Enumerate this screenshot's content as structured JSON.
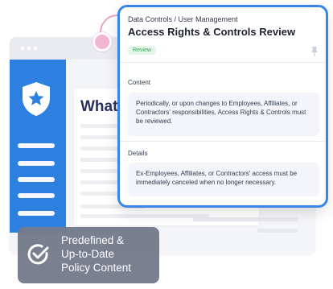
{
  "background": {
    "heading": "What"
  },
  "popup": {
    "breadcrumb": "Data Controls / User Management",
    "title": "Access Rights & Controls Review",
    "status_badge": "Review",
    "content_label": "Content",
    "content_text": "Periodically, or upon changes to Employees, Affiliates, or Contractors' responsibilities, Access Rights & Controls must be reviewed.",
    "details_label": "Details",
    "details_text": "Ex-Employees, Affiliates, or Contractors' access must be immediately canceled when no longer necessary."
  },
  "feature_badge": {
    "lines": [
      "Predefined &",
      "Up-to-Date",
      "Policy Content"
    ]
  },
  "colors": {
    "accent_blue": "#2d7fe0",
    "popup_border": "#3a86e6",
    "badge_bg": "#767b8c",
    "review_green": "#39a75c",
    "connector_pink": "#e8a6c9"
  },
  "icons": [
    "shield-star-icon",
    "pin-icon",
    "check-circle-icon"
  ]
}
